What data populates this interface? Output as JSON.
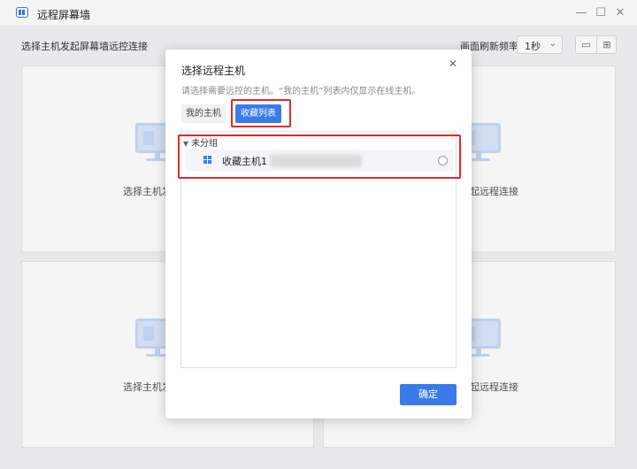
{
  "app": {
    "title": "远程屏幕墙",
    "window_controls": {
      "minimize": "—",
      "maximize": "☐",
      "close": "✕"
    }
  },
  "toolbar": {
    "start_label": "选择主机发起屏幕墙远控连接",
    "refresh_label": "画面刷新频率:",
    "refresh_value": "1秒",
    "layout_single_icon": "single-view-icon",
    "layout_grid_icon": "grid-view-icon"
  },
  "cells": [
    {
      "text": "选择主机发"
    },
    {
      "text": "起远程连接"
    },
    {
      "text": "选择主机发"
    },
    {
      "text": "起远程连接"
    }
  ],
  "dialog": {
    "title": "选择远程主机",
    "description": "请选择需要远控的主机。“我的主机”列表内仅显示在线主机。",
    "tabs": [
      {
        "label": "我的主机",
        "active": false
      },
      {
        "label": "收藏列表",
        "active": true
      }
    ],
    "group_name": "未分组",
    "hosts": [
      {
        "name": "收藏主机1",
        "selected": false
      }
    ],
    "confirm_label": "确定"
  },
  "colors": {
    "accent": "#3b7be8",
    "highlight": "#e02a2a"
  }
}
